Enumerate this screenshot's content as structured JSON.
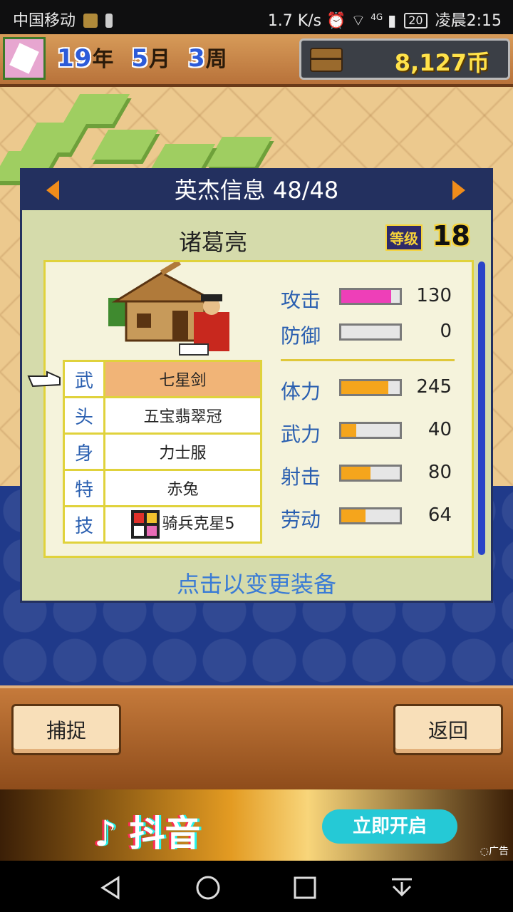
{
  "status_bar": {
    "carrier": "中国移动",
    "net_speed": "1.7 K/s",
    "signal": "4G",
    "battery": "20",
    "time": "凌晨2:15"
  },
  "game_bar": {
    "year": "19",
    "year_unit": "年",
    "month": "5",
    "month_unit": "月",
    "week": "3",
    "week_unit": "周",
    "coins": "8,127币"
  },
  "panel": {
    "title": "英杰信息 48/48",
    "hero_name": "诸葛亮",
    "level_label": "等级",
    "level": "18",
    "equipment": [
      {
        "slot": "武",
        "item": "七星剑"
      },
      {
        "slot": "头",
        "item": "五宝翡翠冠"
      },
      {
        "slot": "身",
        "item": "力士服"
      },
      {
        "slot": "特",
        "item": "赤兔"
      },
      {
        "slot": "技",
        "item": "骑兵克星5"
      }
    ],
    "stats": [
      {
        "label": "攻击",
        "value": "130",
        "fraction": 0.85,
        "color": "#ee3fb8"
      },
      {
        "label": "防御",
        "value": "0",
        "fraction": 0.0,
        "color": "#f5a51c"
      },
      {
        "label": "体力",
        "value": "245",
        "fraction": 0.8,
        "color": "#f5a51c"
      },
      {
        "label": "武力",
        "value": "40",
        "fraction": 0.25,
        "color": "#f5a51c"
      },
      {
        "label": "射击",
        "value": "80",
        "fraction": 0.5,
        "color": "#f5a51c"
      },
      {
        "label": "劳动",
        "value": "64",
        "fraction": 0.42,
        "color": "#f5a51c"
      }
    ],
    "hint": "点击以变更装备"
  },
  "buttons": {
    "capture": "捕捉",
    "back": "返回"
  },
  "ad": {
    "brand": "抖音",
    "cta": "立即开启",
    "tag": "广告"
  }
}
